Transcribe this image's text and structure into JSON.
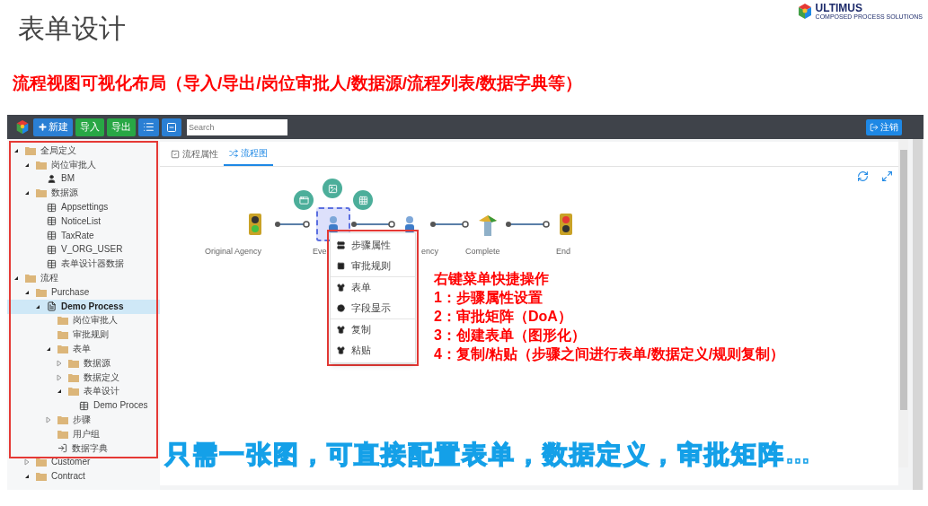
{
  "slide": {
    "title": "表单设计",
    "subtitle": "流程视图可视化布局（导入/导出/岗位审批人/数据源/流程列表/数据字典等）",
    "logo": {
      "name": "ULTIMUS",
      "tagline": "COMPOSED PROCESS SOLUTIONS"
    }
  },
  "toolbar": {
    "buttons": [
      {
        "label": "新建",
        "kind": "new"
      },
      {
        "label": "导入",
        "kind": "import"
      },
      {
        "label": "导出",
        "kind": "export"
      },
      {
        "kind": "list"
      },
      {
        "kind": "collapse"
      }
    ],
    "search": {
      "placeholder": "Search"
    },
    "logout": "注销"
  },
  "tree": [
    {
      "label": "全局定义",
      "kind": "folder",
      "expanded": true,
      "selected": false,
      "children": [
        {
          "label": "岗位审批人",
          "kind": "folder",
          "expanded": true,
          "selected": false,
          "children": [
            {
              "label": "BM",
              "kind": "user",
              "selected": false
            }
          ]
        },
        {
          "label": "数据源",
          "kind": "folder",
          "expanded": true,
          "selected": false,
          "children": [
            {
              "label": "Appsettings",
              "kind": "table",
              "selected": false
            },
            {
              "label": "NoticeList",
              "kind": "table",
              "selected": false
            },
            {
              "label": "TaxRate",
              "kind": "table",
              "selected": false
            },
            {
              "label": "V_ORG_USER",
              "kind": "table",
              "selected": false
            },
            {
              "label": "表单设计器数据",
              "kind": "table",
              "selected": false
            }
          ]
        }
      ]
    },
    {
      "label": "流程",
      "kind": "folder",
      "expanded": true,
      "selected": false,
      "children": [
        {
          "label": "Purchase",
          "kind": "folder",
          "expanded": true,
          "selected": false,
          "children": [
            {
              "label": "Demo Process",
              "kind": "process",
              "expanded": true,
              "selected": true,
              "children": [
                {
                  "label": "岗位审批人",
                  "kind": "folder",
                  "selected": false
                },
                {
                  "label": "审批规则",
                  "kind": "folder",
                  "selected": false
                },
                {
                  "label": "表单",
                  "kind": "folder",
                  "expanded": true,
                  "selected": false,
                  "children": [
                    {
                      "label": "数据源",
                      "kind": "folder",
                      "expanded": false,
                      "selected": false
                    },
                    {
                      "label": "数据定义",
                      "kind": "folder",
                      "expanded": false,
                      "selected": false
                    },
                    {
                      "label": "表单设计",
                      "kind": "folder",
                      "expanded": true,
                      "selected": false,
                      "children": [
                        {
                          "label": "Demo Proces",
                          "kind": "table",
                          "selected": false
                        }
                      ]
                    }
                  ]
                },
                {
                  "label": "步骤",
                  "kind": "folder",
                  "expanded": false,
                  "selected": false
                },
                {
                  "label": "用户组",
                  "kind": "folder",
                  "selected": false
                },
                {
                  "label": "数据字典",
                  "kind": "link",
                  "selected": false
                }
              ]
            }
          ]
        },
        {
          "label": "Customer",
          "kind": "folder",
          "expanded": false,
          "selected": false
        },
        {
          "label": "Contract",
          "kind": "folder",
          "expanded": true,
          "selected": false
        }
      ]
    }
  ],
  "tabs": [
    {
      "label": "流程属性",
      "kind": "properties",
      "selected": false
    },
    {
      "label": "流程图",
      "kind": "diagram",
      "selected": true
    }
  ],
  "diagram": {
    "nodes": [
      {
        "label": "Original Agency",
        "kind": "start",
        "selected": false
      },
      {
        "label": "Eve",
        "kind": "person",
        "selected": true
      },
      {
        "label": "ency",
        "kind": "person",
        "selected": false
      },
      {
        "label": "Complete",
        "kind": "complete",
        "selected": false
      },
      {
        "label": "End",
        "kind": "end",
        "selected": false
      }
    ],
    "context_menu": {
      "groups": [
        [
          {
            "label": "步骤属性",
            "kind": "steps"
          },
          {
            "label": "审批规则",
            "kind": "rules"
          }
        ],
        [
          {
            "label": "表单",
            "kind": "form"
          },
          {
            "label": "字段显示",
            "kind": "fields"
          }
        ],
        [
          {
            "label": "复制",
            "kind": "copy"
          },
          {
            "label": "粘贴",
            "kind": "paste"
          }
        ]
      ]
    }
  },
  "annotations": {
    "menu_notes": [
      "右键菜单快捷操作",
      "1：步骤属性设置",
      "2：审批矩阵（DoA）",
      "3：创建表单（图形化）",
      "4：复制/粘贴（步骤之间进行表单/数据定义/规则复制）"
    ],
    "footer": "只需一张图，可直接配置表单，数据定义，审批矩阵…"
  }
}
